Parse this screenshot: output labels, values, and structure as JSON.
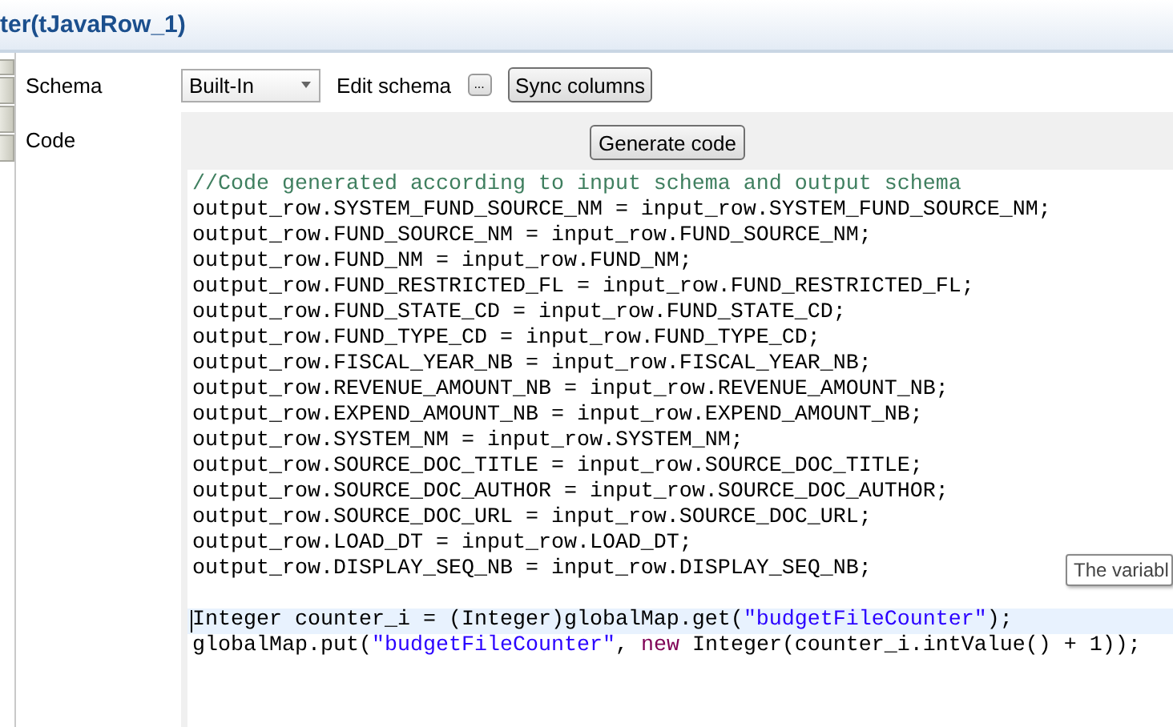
{
  "window": {
    "title": "ter(tJavaRow_1)"
  },
  "schema": {
    "label": "Schema",
    "dropdown": {
      "value": "Built-In"
    },
    "edit_label": "Edit schema",
    "ellipsis_button": "...",
    "sync_button": "Sync columns"
  },
  "code": {
    "label": "Code",
    "generate_button": "Generate code",
    "lines": [
      {
        "kind": "code",
        "current": false,
        "segments": [
          {
            "kind": "comment",
            "text": "//Code generated according to input schema and output schema"
          }
        ]
      },
      {
        "kind": "code",
        "current": false,
        "segments": [
          {
            "kind": "plain",
            "text": "output_row.SYSTEM_FUND_SOURCE_NM = input_row.SYSTEM_FUND_SOURCE_NM;"
          }
        ]
      },
      {
        "kind": "code",
        "current": false,
        "segments": [
          {
            "kind": "plain",
            "text": "output_row.FUND_SOURCE_NM = input_row.FUND_SOURCE_NM;"
          }
        ]
      },
      {
        "kind": "code",
        "current": false,
        "segments": [
          {
            "kind": "plain",
            "text": "output_row.FUND_NM = input_row.FUND_NM;"
          }
        ]
      },
      {
        "kind": "code",
        "current": false,
        "segments": [
          {
            "kind": "plain",
            "text": "output_row.FUND_RESTRICTED_FL = input_row.FUND_RESTRICTED_FL;"
          }
        ]
      },
      {
        "kind": "code",
        "current": false,
        "segments": [
          {
            "kind": "plain",
            "text": "output_row.FUND_STATE_CD = input_row.FUND_STATE_CD;"
          }
        ]
      },
      {
        "kind": "code",
        "current": false,
        "segments": [
          {
            "kind": "plain",
            "text": "output_row.FUND_TYPE_CD = input_row.FUND_TYPE_CD;"
          }
        ]
      },
      {
        "kind": "code",
        "current": false,
        "segments": [
          {
            "kind": "plain",
            "text": "output_row.FISCAL_YEAR_NB = input_row.FISCAL_YEAR_NB;"
          }
        ]
      },
      {
        "kind": "code",
        "current": false,
        "segments": [
          {
            "kind": "plain",
            "text": "output_row.REVENUE_AMOUNT_NB = input_row.REVENUE_AMOUNT_NB;"
          }
        ]
      },
      {
        "kind": "code",
        "current": false,
        "segments": [
          {
            "kind": "plain",
            "text": "output_row.EXPEND_AMOUNT_NB = input_row.EXPEND_AMOUNT_NB;"
          }
        ]
      },
      {
        "kind": "code",
        "current": false,
        "segments": [
          {
            "kind": "plain",
            "text": "output_row.SYSTEM_NM = input_row.SYSTEM_NM;"
          }
        ]
      },
      {
        "kind": "code",
        "current": false,
        "segments": [
          {
            "kind": "plain",
            "text": "output_row.SOURCE_DOC_TITLE = input_row.SOURCE_DOC_TITLE;"
          }
        ]
      },
      {
        "kind": "code",
        "current": false,
        "segments": [
          {
            "kind": "plain",
            "text": "output_row.SOURCE_DOC_AUTHOR = input_row.SOURCE_DOC_AUTHOR;"
          }
        ]
      },
      {
        "kind": "code",
        "current": false,
        "segments": [
          {
            "kind": "plain",
            "text": "output_row.SOURCE_DOC_URL = input_row.SOURCE_DOC_URL;"
          }
        ]
      },
      {
        "kind": "code",
        "current": false,
        "segments": [
          {
            "kind": "plain",
            "text": "output_row.LOAD_DT = input_row.LOAD_DT;"
          }
        ]
      },
      {
        "kind": "code",
        "current": false,
        "segments": [
          {
            "kind": "plain",
            "text": "output_row.DISPLAY_SEQ_NB = input_row.DISPLAY_SEQ_NB;"
          }
        ]
      },
      {
        "kind": "blank",
        "current": false
      },
      {
        "kind": "code",
        "current": true,
        "segments": [
          {
            "kind": "plain",
            "text": "Integer counter_i = (Integer)globalMap.get("
          },
          {
            "kind": "string",
            "text": "\"budgetFileCounter\""
          },
          {
            "kind": "plain",
            "text": ");"
          }
        ]
      },
      {
        "kind": "code",
        "current": false,
        "segments": [
          {
            "kind": "plain",
            "text": "globalMap.put("
          },
          {
            "kind": "string",
            "text": "\"budgetFileCounter\""
          },
          {
            "kind": "plain",
            "text": ", "
          },
          {
            "kind": "keyword",
            "text": "new"
          },
          {
            "kind": "plain",
            "text": " Integer(counter_i.intValue() + 1));"
          }
        ]
      }
    ],
    "tooltip": "The variabl"
  }
}
